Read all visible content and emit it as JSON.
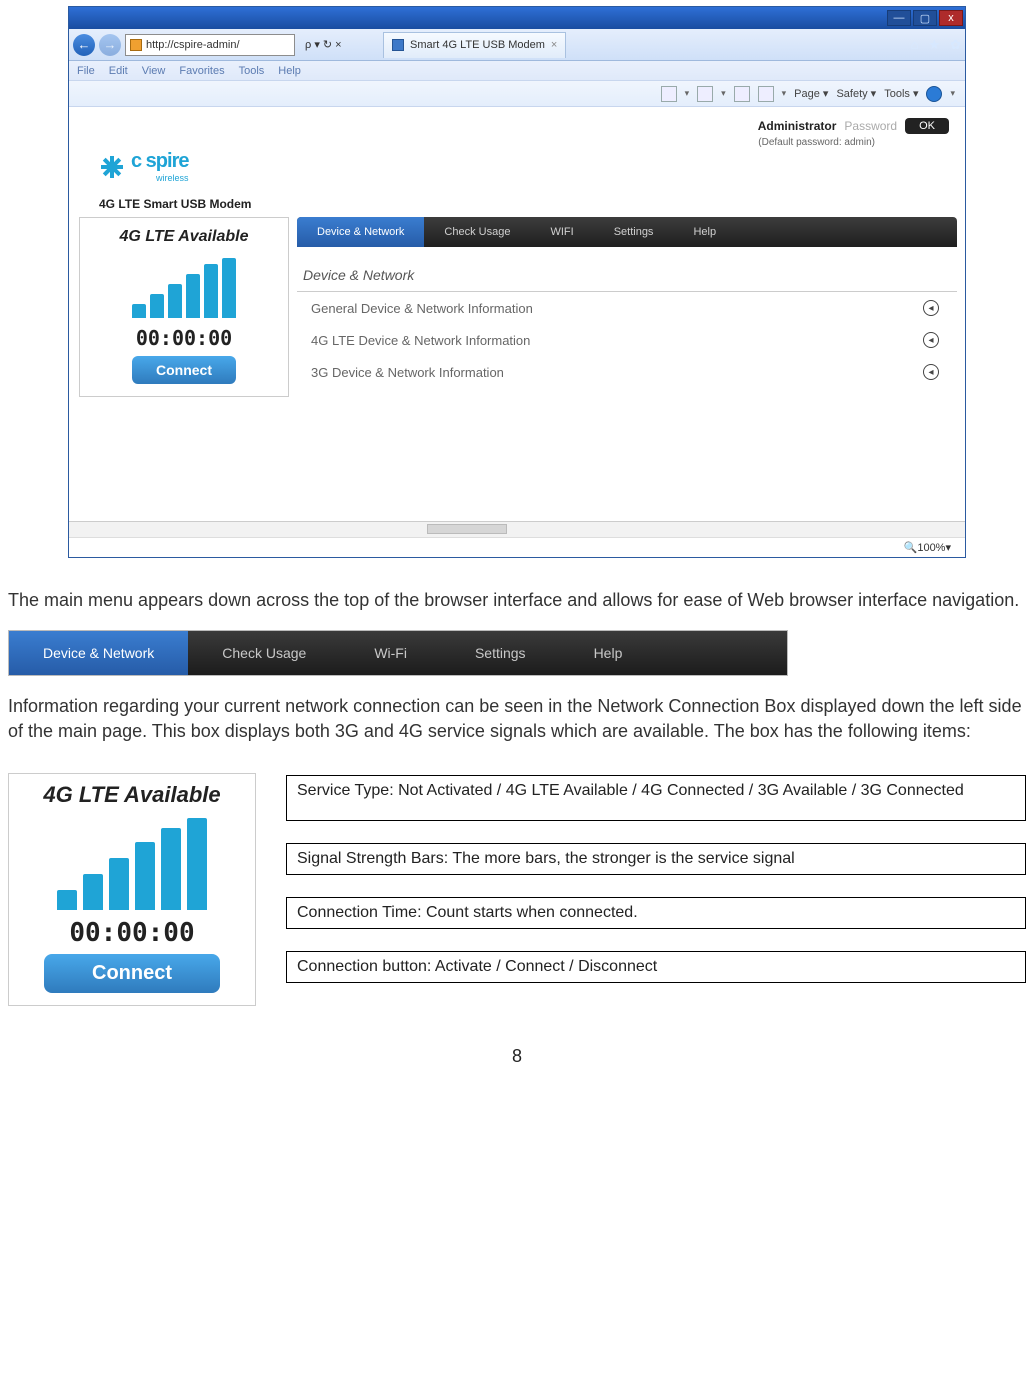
{
  "browser": {
    "window_controls": {
      "min": "—",
      "max": "▢",
      "close": "x"
    },
    "url": "http://cspire-admin/",
    "search_controls": "ρ ▾ ↻ ×",
    "tab_title": "Smart 4G LTE USB Modem",
    "tab_close": "×",
    "title_icons": {
      "home": "⌂",
      "star": "★",
      "gear": "✿"
    },
    "menubar": [
      "File",
      "Edit",
      "View",
      "Favorites",
      "Tools",
      "Help"
    ],
    "toolbar_items": [
      "Page ▾",
      "Safety ▾",
      "Tools ▾"
    ],
    "zoom": "100%"
  },
  "admin": {
    "label": "Administrator",
    "placeholder": "Password",
    "ok": "OK",
    "hint": "(Default password: admin)"
  },
  "brand": {
    "name": "c spire",
    "sub": "wireless"
  },
  "modem_title": "4G LTE Smart USB Modem",
  "nav_tabs": {
    "items": [
      "Device & Network",
      "Check Usage",
      "WIFI",
      "Settings",
      "Help"
    ],
    "active_index": 0
  },
  "conn_box": {
    "title": "4G LTE Available",
    "timer": "00:00:00",
    "button": "Connect"
  },
  "section": {
    "title": "Device & Network",
    "rows": [
      "General Device & Network Information",
      "4G LTE Device & Network Information",
      "3G Device & Network Information"
    ]
  },
  "para1": "The main menu appears down across the top of the browser interface and allows for ease of Web browser interface navigation.",
  "tabs_figure": {
    "items": [
      "Device & Network",
      "Check Usage",
      "Wi-Fi",
      "Settings",
      "Help"
    ],
    "active_index": 0
  },
  "para2": "Information regarding your current network connection can be seen in the Network Connection Box displayed down the left side of the main page. This box displays both 3G and 4G service signals which are available. The box has the following items:",
  "conn_large": {
    "title": "4G LTE Available",
    "timer": "00:00:00",
    "button": "Connect"
  },
  "callouts": [
    "Service Type: Not Activated / 4G LTE Available / 4G Connected  / 3G Available / 3G Connected",
    "Signal Strength Bars: The more bars, the stronger is the service signal",
    "Connection Time: Count starts when connected.",
    "Connection button: Activate / Connect  / Disconnect"
  ],
  "page_number": "8"
}
